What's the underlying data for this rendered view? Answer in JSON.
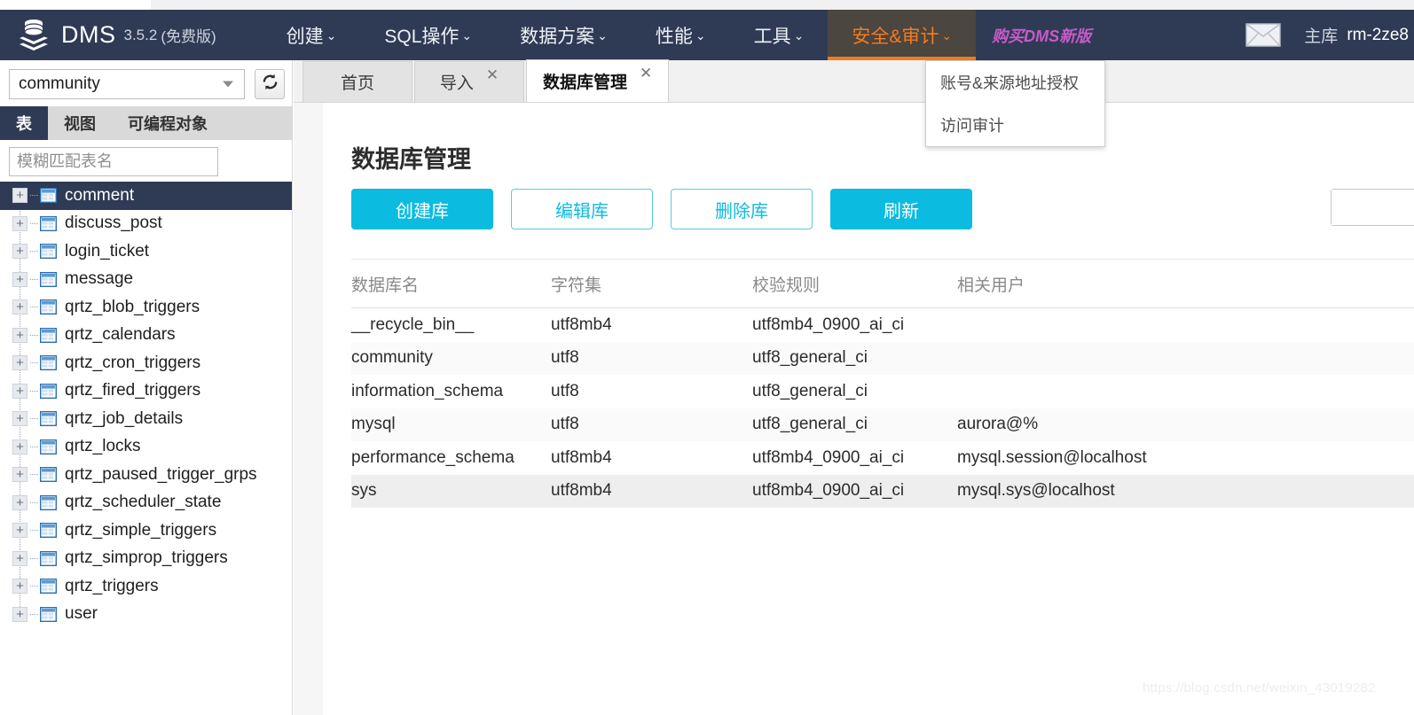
{
  "brand": {
    "name": "DMS",
    "version": "3.5.2",
    "edition": "(免费版)",
    "logo_icon": "database-stack-icon"
  },
  "header": {
    "nav": [
      {
        "label": "创建",
        "caret": "⌄",
        "active": false
      },
      {
        "label": "SQL操作",
        "caret": "⌄",
        "active": false
      },
      {
        "label": "数据方案",
        "caret": "⌄",
        "active": false
      },
      {
        "label": "性能",
        "caret": "⌄",
        "active": false
      },
      {
        "label": "工具",
        "caret": "⌄",
        "active": false
      },
      {
        "label": "安全&审计",
        "caret": "⌄",
        "active": true
      }
    ],
    "promo_label": "购买DMS新版",
    "mail_icon": "envelope-icon",
    "host_label": "主库",
    "host_name": "rm-2ze8",
    "accent_color": "#f47b20",
    "bar_color": "#2f3b55",
    "promo_color": "#c75bc7"
  },
  "security_menu": {
    "items": [
      {
        "label": "账号&来源地址授权"
      },
      {
        "label": "访问审计"
      }
    ]
  },
  "sidebar": {
    "database_select": {
      "value": "community",
      "caret_icon": "chevron-down-icon"
    },
    "refresh_icon": "refresh-icon",
    "object_tabs": [
      {
        "label": "表",
        "active": true
      },
      {
        "label": "视图",
        "active": false
      },
      {
        "label": "可编程对象",
        "active": false
      }
    ],
    "filter": {
      "value": "",
      "placeholder": "模糊匹配表名"
    },
    "expander_glyph": "+",
    "table_icon": "table-icon",
    "tables": [
      {
        "label": "comment",
        "selected": true
      },
      {
        "label": "discuss_post",
        "selected": false
      },
      {
        "label": "login_ticket",
        "selected": false
      },
      {
        "label": "message",
        "selected": false
      },
      {
        "label": "qrtz_blob_triggers",
        "selected": false
      },
      {
        "label": "qrtz_calendars",
        "selected": false
      },
      {
        "label": "qrtz_cron_triggers",
        "selected": false
      },
      {
        "label": "qrtz_fired_triggers",
        "selected": false
      },
      {
        "label": "qrtz_job_details",
        "selected": false
      },
      {
        "label": "qrtz_locks",
        "selected": false
      },
      {
        "label": "qrtz_paused_trigger_grps",
        "selected": false
      },
      {
        "label": "qrtz_scheduler_state",
        "selected": false
      },
      {
        "label": "qrtz_simple_triggers",
        "selected": false
      },
      {
        "label": "qrtz_simprop_triggers",
        "selected": false
      },
      {
        "label": "qrtz_triggers",
        "selected": false
      },
      {
        "label": "user",
        "selected": false
      }
    ]
  },
  "main": {
    "tabs": [
      {
        "label": "首页",
        "active": false,
        "closable": false
      },
      {
        "label": "导入",
        "active": false,
        "closable": true
      },
      {
        "label": "数据库管理",
        "active": true,
        "closable": true
      }
    ],
    "close_glyph": "✕",
    "page_title": "数据库管理",
    "buttons": [
      {
        "label": "创建库",
        "style": "primary"
      },
      {
        "label": "编辑库",
        "style": "ghost"
      },
      {
        "label": "删除库",
        "style": "ghost"
      },
      {
        "label": "刷新",
        "style": "primary"
      }
    ],
    "search": {
      "value": "",
      "placeholder": ""
    },
    "accent_color": "#0cbbe0",
    "grid": {
      "columns": [
        "数据库名",
        "字符集",
        "校验规则",
        "相关用户"
      ],
      "rows": [
        {
          "cells": [
            "__recycle_bin__",
            "utf8mb4",
            "utf8mb4_0900_ai_ci",
            ""
          ],
          "state": "normal"
        },
        {
          "cells": [
            "community",
            "utf8",
            "utf8_general_ci",
            ""
          ],
          "state": "alt"
        },
        {
          "cells": [
            "information_schema",
            "utf8",
            "utf8_general_ci",
            ""
          ],
          "state": "normal"
        },
        {
          "cells": [
            "mysql",
            "utf8",
            "utf8_general_ci",
            "aurora@%"
          ],
          "state": "alt"
        },
        {
          "cells": [
            "performance_schema",
            "utf8mb4",
            "utf8mb4_0900_ai_ci",
            "mysql.session@localhost"
          ],
          "state": "normal"
        },
        {
          "cells": [
            "sys",
            "utf8mb4",
            "utf8mb4_0900_ai_ci",
            "mysql.sys@localhost"
          ],
          "state": "sel"
        }
      ]
    }
  },
  "watermark": {
    "text": "https://blog.csdn.net/weixin_43019282"
  }
}
